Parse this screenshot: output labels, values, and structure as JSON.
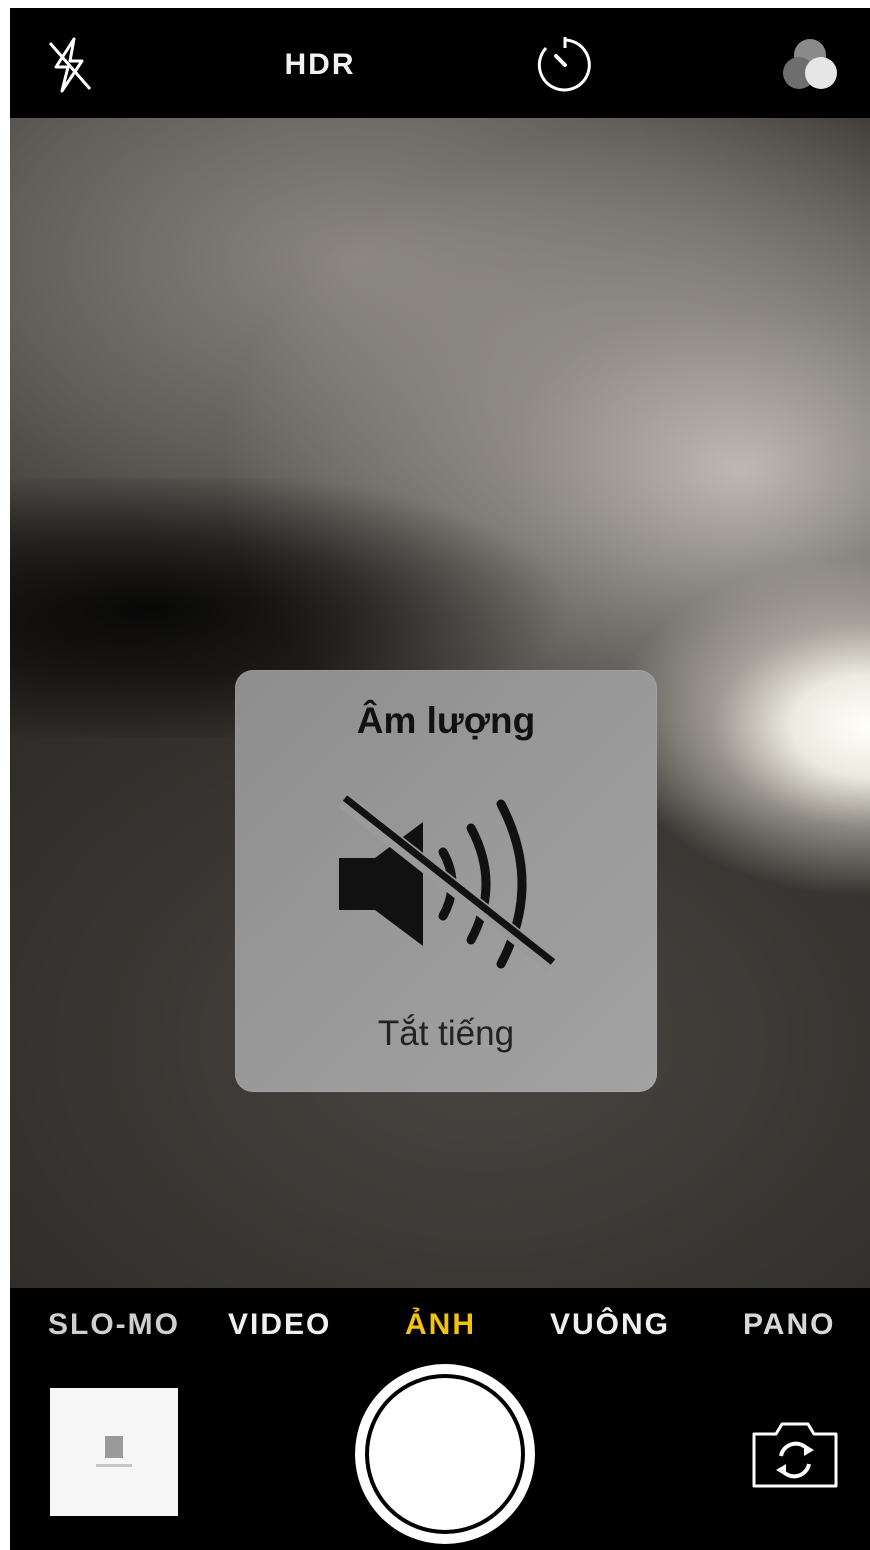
{
  "top_bar": {
    "flash_icon": "flash-off-icon",
    "hdr_label": "HDR",
    "timer_icon": "timer-icon",
    "filters_icon": "filters-icon"
  },
  "volume_hud": {
    "title": "Âm lượng",
    "icon": "speaker-muted-icon",
    "status": "Tắt tiếng"
  },
  "modes": {
    "items": [
      "SLO-MO",
      "VIDEO",
      "ẢNH",
      "VUÔNG",
      "PANO"
    ],
    "selected": "ẢNH",
    "selected_color": "#f4c20d"
  },
  "controls": {
    "thumbnail": "last-photo-thumbnail",
    "shutter": "shutter-button",
    "flip_icon": "flip-camera-icon"
  }
}
